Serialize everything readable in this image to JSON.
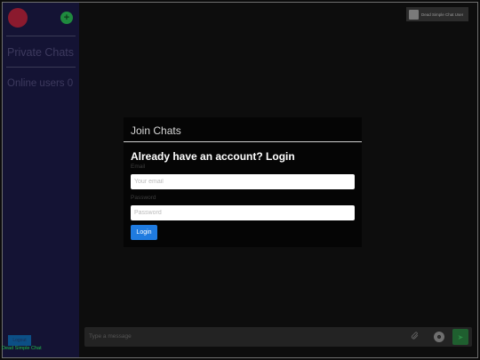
{
  "sidebar": {
    "title": "Private Chats",
    "online": "Online users 0",
    "add_symbol": "+",
    "logout_label": "Logout"
  },
  "header": {
    "profile_name": "Dead Simple Chat User"
  },
  "message_bar": {
    "placeholder": "Type a message",
    "attach_icon": "paperclip-icon",
    "emoji_icon": "emoji-icon",
    "send_icon": "send-icon"
  },
  "modal": {
    "title": "Join Chats",
    "heading": "Already have an account? Login",
    "email_label": "Email",
    "email_placeholder": "Your email",
    "password_label": "Password",
    "password_placeholder": "Password",
    "login_button": "Login"
  },
  "footer": {
    "text": "Dead Simple Chat"
  },
  "colors": {
    "sidebar_bg": "#141334",
    "accent_blue": "#1f7be0",
    "accent_green": "#1f8a3e",
    "avatar_red": "#8b1a2e"
  }
}
